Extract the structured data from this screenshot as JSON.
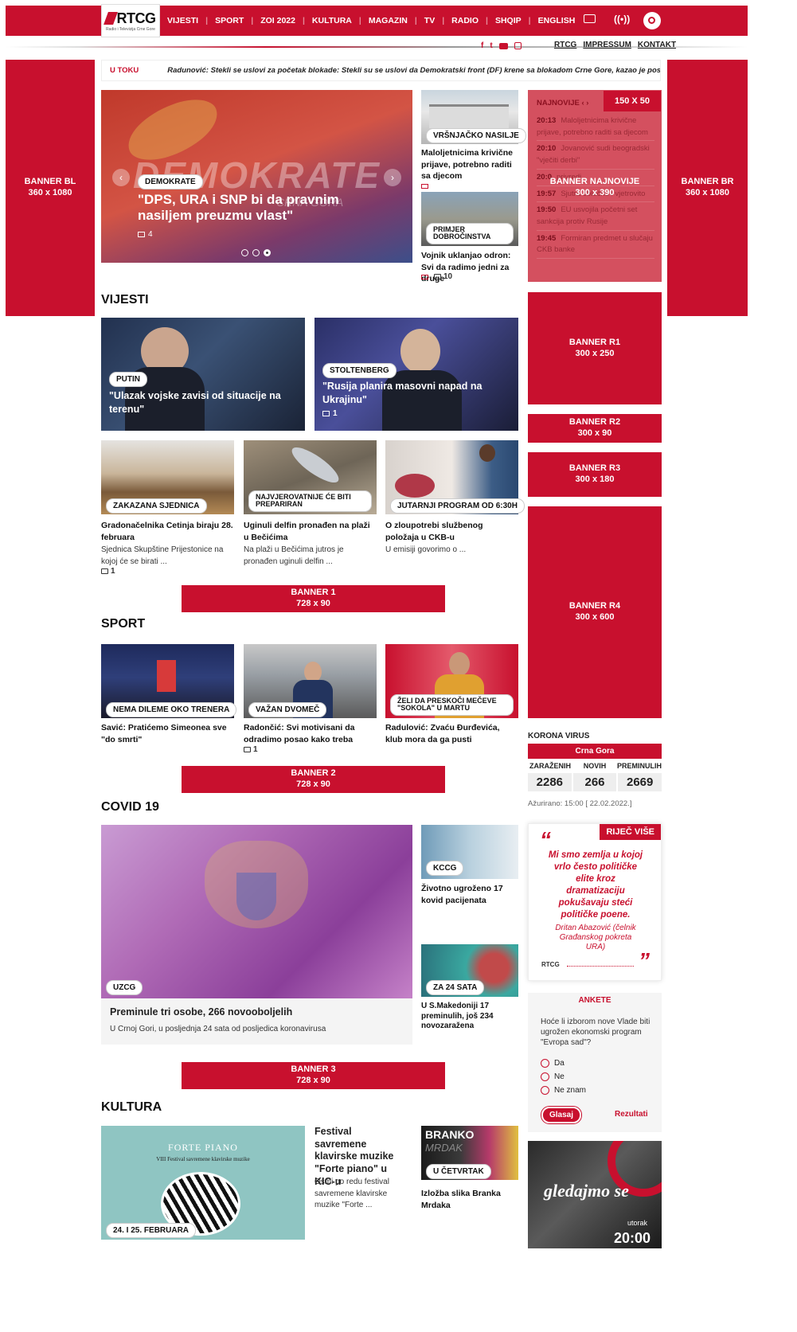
{
  "brand": {
    "logo": "RTCG",
    "logo_sub": "Radio i Televizija Crne Gore"
  },
  "nav": {
    "items": [
      "VIJESTI",
      "SPORT",
      "ZOI 2022",
      "KULTURA",
      "MAGAZIN",
      "TV",
      "RADIO",
      "SHQIP",
      "ENGLISH"
    ]
  },
  "subnav": {
    "links": [
      "RTCG",
      "IMPRESSUM",
      "KONTAKT"
    ]
  },
  "ticker": {
    "label": "U TOKU",
    "text": "Radunović: Stekli se uslovi za početak blokade: Stekli su se uslovi da Demokratski front (DF) krene sa blokadom Crne Gore, kazao je poslanik tog politič"
  },
  "banners": {
    "bl": {
      "name": "BANNER BL",
      "size": "360 x 1080"
    },
    "br": {
      "name": "BANNER BR",
      "size": "360 x 1080"
    },
    "najnovije": {
      "name": "BANNER NAJNOVIJE",
      "size": "300 x 390"
    },
    "small": "150 X 50",
    "r1": {
      "name": "BANNER R1",
      "size": "300 x 250"
    },
    "r2": {
      "name": "BANNER R2",
      "size": "300 x 90"
    },
    "r3": {
      "name": "BANNER R3",
      "size": "300 x 180"
    },
    "r4": {
      "name": "BANNER R4",
      "size": "300 x 600"
    },
    "b1": {
      "name": "BANNER 1",
      "size": "728 x 90"
    },
    "b2": {
      "name": "BANNER 2",
      "size": "728 x 90"
    },
    "b3": {
      "name": "BANNER 3",
      "size": "728 x 90"
    }
  },
  "hero": {
    "tag": "DEMOKRATE",
    "title": "\"DPS, URA i SNP bi da pravnim nasiljem preuzmu vlast\"",
    "comments": "4",
    "bg_text": "DEMOKRATE",
    "bg_sub": "CRNA GORA"
  },
  "side_stories": [
    {
      "tag": "VRŠNJAČKO NASILJE",
      "title": "Maloljetnicima krivične prijave, potrebno raditi sa djecom"
    },
    {
      "tag": "PRIMJER DOBROČINSTVA",
      "title": "Vojnik uklanjao odron: Svi da radimo jedni za druge",
      "comments": "10"
    }
  ],
  "najnovije": {
    "title": "NAJNOVIJE",
    "items": [
      {
        "time": "20:13",
        "text": "Maloljetnicima krivične prijave, potrebno raditi sa djecom"
      },
      {
        "time": "20:10",
        "text": "Jovanović sudi beogradski \"vječiti derbi\""
      },
      {
        "time": "20:0",
        "text": "privredi"
      },
      {
        "time": "19:57",
        "text": "Sjutra oblačno i vjetrovito"
      },
      {
        "time": "19:50",
        "text": "EU usvojila početni set sankcija protiv Rusije"
      },
      {
        "time": "19:45",
        "text": "Formiran predmet u slučaju CKB banke"
      }
    ]
  },
  "vijesti": {
    "heading": "VIJESTI",
    "big": [
      {
        "tag": "PUTIN",
        "title": "\"Ulazak vojske zavisi od situacije na terenu\""
      },
      {
        "tag": "STOLTENBERG",
        "title": "\"Rusija planira masovni napad na Ukrajinu\"",
        "comments": "1"
      }
    ],
    "small": [
      {
        "tag": "ZAKAZANA SJEDNICA",
        "title": "Gradonačelnika Cetinja biraju 28. februara",
        "lead": "Sjednica Skupštine Prijestonice na kojoj će se birati ...",
        "comments": "1"
      },
      {
        "tag": "NAJVJEROVATNIJE ĆE BITI PREPARIRAN",
        "title": "Uginuli delfin pronađen na plaži u Bečićima",
        "lead": "Na plaži u Bečićima jutros je pronađen uginuli delfin ..."
      },
      {
        "tag": "JUTARNJI PROGRAM OD 6:30H",
        "title": "O zloupotrebi službenog položaja u CKB-u",
        "lead": "U emisiji govorimo o ..."
      }
    ]
  },
  "sport": {
    "heading": "SPORT",
    "items": [
      {
        "tag": "NEMA DILEME OKO TRENERA",
        "title": "Savić: Pratićemo Simeonea sve \"do smrti\""
      },
      {
        "tag": "VAŽAN DVOMEČ",
        "title": "Radončić: Svi motivisani da odradimo posao kako treba",
        "comments": "1"
      },
      {
        "tag": "ŽELI DA PRESKOČI MEČEVE \"SOKOLA\" U MARTU",
        "title": "Radulović: Zvaću Đurđevića, klub mora da ga pusti"
      }
    ]
  },
  "korona": {
    "title": "KORONA VIRUS",
    "region": "Crna Gora",
    "headers": [
      "ZARAŽENIH",
      "NOVIH",
      "PREMINULIH"
    ],
    "values": [
      "2286",
      "266",
      "2669"
    ],
    "updated": "Ažurirano: 15:00 [ 22.02.2022.]"
  },
  "covid": {
    "heading": "COVID 19",
    "main": {
      "tag": "UZCG",
      "title": "Preminule tri osobe, 266 novooboljelih",
      "lead": "U Crnoj Gori, u posljednja 24 sata od posljedica koronavirusa"
    },
    "side": [
      {
        "tag": "KCCG",
        "title": "Životno ugroženo 17 kovid pacijenata"
      },
      {
        "tag": "ZA 24 SATA",
        "title": "U S.Makedoniji 17 preminulih, još 234 novozaražena"
      }
    ]
  },
  "rijec": {
    "label": "RIJEČ VIŠE",
    "quote": "Mi smo zemlja u kojoj vrlo često političke elite kroz dramatizaciju pokušavaju steći političke poene.",
    "author": "Dritan Abazović (čelnik Građanskog pokreta URA)",
    "logo": "RTCG"
  },
  "anketa": {
    "title": "ANKETE",
    "question": "Hoće li izborom nove Vlade biti ugrožen ekonomski program \"Evropa sad\"?",
    "options": [
      "Da",
      "Ne",
      "Ne znam"
    ],
    "vote": "Glasaj",
    "results": "Rezultati"
  },
  "kultura": {
    "heading": "KULTURA",
    "poster_title": "FORTE PIANO",
    "poster_sub": "VIII Festival savremene klavirske muzike",
    "poster_tag": "24. i 25. FEBRUARA",
    "title": "Festival savremene klavirske muzike \"Forte piano\" u KIC-u",
    "lead": "Osmi po redu festival savremene klavirske muzike \"Forte ...",
    "side": {
      "name": "BRANKO",
      "name2": "MRDAK",
      "tag": "U ČETVRTAK",
      "title": "Izložba slika Branka Mrdaka"
    }
  },
  "promo": {
    "text": "gledajmo se",
    "day": "utorak",
    "time": "20:00"
  },
  "colors": {
    "accent": "#c8102e"
  }
}
